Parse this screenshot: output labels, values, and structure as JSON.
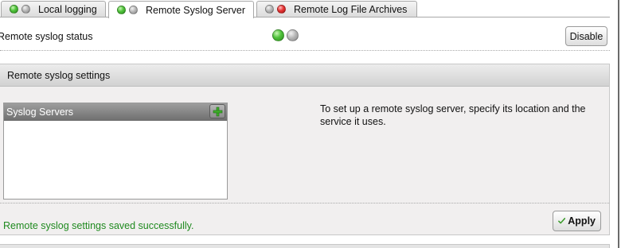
{
  "tabs": [
    {
      "label": "Local logging",
      "indicators": [
        "green",
        "gray"
      ],
      "active": false
    },
    {
      "label": "Remote Syslog Server",
      "indicators": [
        "green",
        "gray"
      ],
      "active": true
    },
    {
      "label": "Remote Log File Archives",
      "indicators": [
        "gray",
        "red"
      ],
      "active": false
    }
  ],
  "status": {
    "label": "Remote syslog status",
    "indicators": [
      "green",
      "gray"
    ],
    "disable_label": "Disable"
  },
  "settings": {
    "header": "Remote syslog settings",
    "servers_title": "Syslog Servers",
    "add_icon": "plus-icon",
    "servers": [],
    "help_text": "To set up a remote syslog server, specify its location and the service it uses.",
    "success_message": "Remote syslog settings saved successfully.",
    "apply_label": "Apply",
    "apply_icon": "checkmark-icon"
  },
  "colors": {
    "success_text": "#1f8a1f",
    "indicator_green": "#4fc23a",
    "indicator_red": "#e73434",
    "indicator_gray": "#b4b4b4"
  }
}
